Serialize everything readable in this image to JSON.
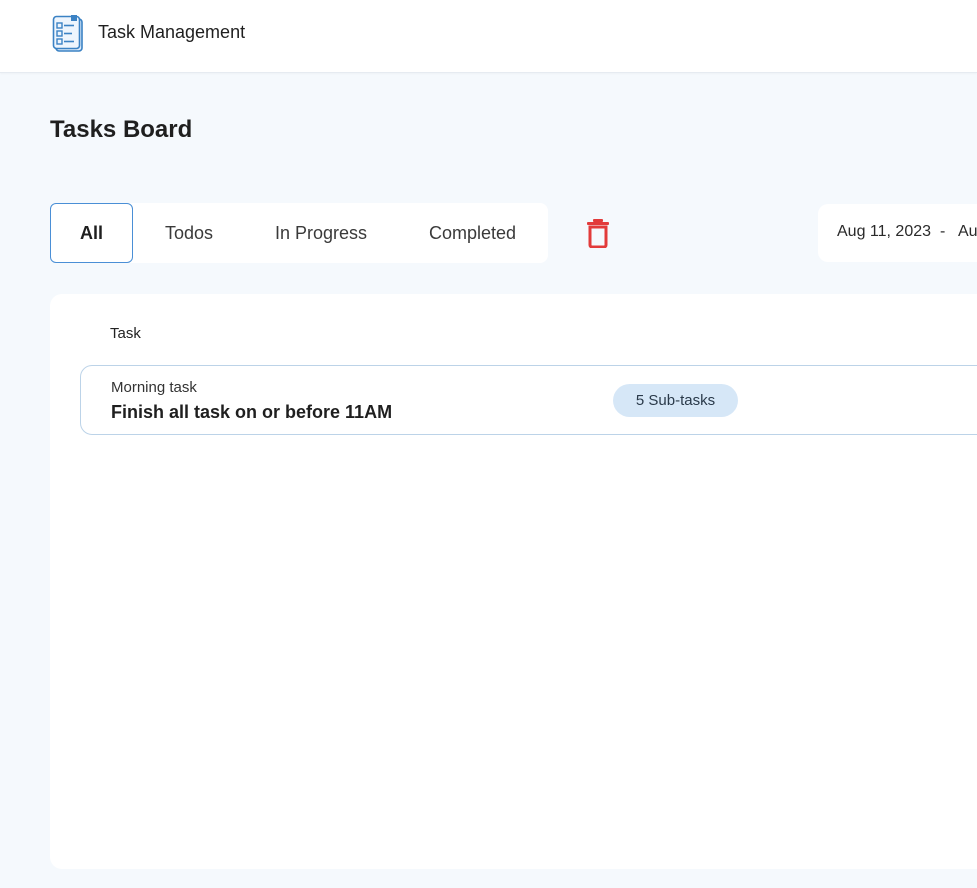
{
  "header": {
    "app_title": "Task Management",
    "logo_icon": "clipboard-checklist-icon"
  },
  "page": {
    "title": "Tasks Board"
  },
  "filters": {
    "tabs": [
      {
        "label": "All",
        "active": true
      },
      {
        "label": "Todos",
        "active": false
      },
      {
        "label": "In Progress",
        "active": false
      },
      {
        "label": "Completed",
        "active": false
      }
    ],
    "delete_icon": "trash-icon"
  },
  "date_range": {
    "start": "Aug 11, 2023",
    "separator": "-",
    "end_visible": "Au"
  },
  "table": {
    "column_task": "Task",
    "rows": [
      {
        "category": "Morning task",
        "title": "Finish all task on or before 11AM",
        "subtasks": "5 Sub-tasks"
      }
    ]
  },
  "colors": {
    "accent": "#4a8fd6",
    "danger": "#e23b3b",
    "badge_bg": "#d6e7f7",
    "page_bg": "#f5f9fd"
  }
}
